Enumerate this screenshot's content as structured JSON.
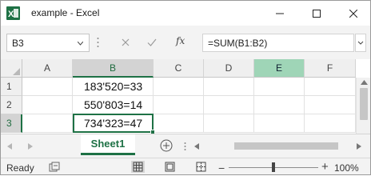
{
  "window": {
    "title": "example - Excel",
    "controls": {
      "minimize_icon": "minimize-icon",
      "maximize_icon": "maximize-icon",
      "close_icon": "close-icon"
    }
  },
  "formula_bar": {
    "name_box": "B3",
    "fx_label": "fx",
    "formula": "=SUM(B1:B2)"
  },
  "grid": {
    "columns": [
      "A",
      "B",
      "C",
      "D",
      "E",
      "F"
    ],
    "rows": [
      {
        "label": "1",
        "B": "183'520=33"
      },
      {
        "label": "2",
        "B": "550'803=14"
      },
      {
        "label": "3",
        "B": "734'323=47"
      }
    ],
    "active_cell": "B3"
  },
  "sheets": {
    "tabs": [
      "Sheet1"
    ],
    "active": "Sheet1"
  },
  "status": {
    "ready": "Ready",
    "zoom_level": "100%",
    "zoom_fraction": 0.5
  },
  "colors": {
    "accent": "#1e7145",
    "selected_header": "#9fd5b7"
  }
}
